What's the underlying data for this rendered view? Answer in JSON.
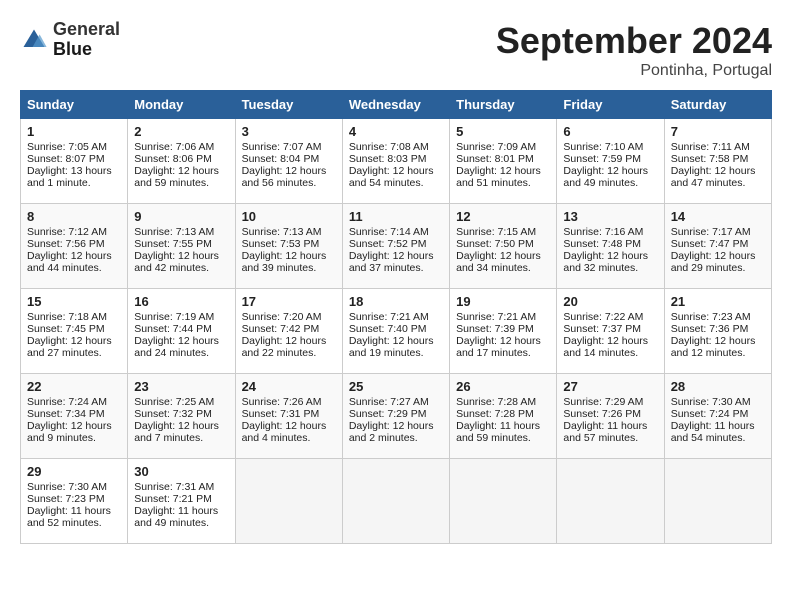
{
  "header": {
    "logo_line1": "General",
    "logo_line2": "Blue",
    "month_title": "September 2024",
    "location": "Pontinha, Portugal"
  },
  "days_of_week": [
    "Sunday",
    "Monday",
    "Tuesday",
    "Wednesday",
    "Thursday",
    "Friday",
    "Saturday"
  ],
  "weeks": [
    [
      {
        "day": "1",
        "lines": [
          "Sunrise: 7:05 AM",
          "Sunset: 8:07 PM",
          "Daylight: 13 hours",
          "and 1 minute."
        ]
      },
      {
        "day": "2",
        "lines": [
          "Sunrise: 7:06 AM",
          "Sunset: 8:06 PM",
          "Daylight: 12 hours",
          "and 59 minutes."
        ]
      },
      {
        "day": "3",
        "lines": [
          "Sunrise: 7:07 AM",
          "Sunset: 8:04 PM",
          "Daylight: 12 hours",
          "and 56 minutes."
        ]
      },
      {
        "day": "4",
        "lines": [
          "Sunrise: 7:08 AM",
          "Sunset: 8:03 PM",
          "Daylight: 12 hours",
          "and 54 minutes."
        ]
      },
      {
        "day": "5",
        "lines": [
          "Sunrise: 7:09 AM",
          "Sunset: 8:01 PM",
          "Daylight: 12 hours",
          "and 51 minutes."
        ]
      },
      {
        "day": "6",
        "lines": [
          "Sunrise: 7:10 AM",
          "Sunset: 7:59 PM",
          "Daylight: 12 hours",
          "and 49 minutes."
        ]
      },
      {
        "day": "7",
        "lines": [
          "Sunrise: 7:11 AM",
          "Sunset: 7:58 PM",
          "Daylight: 12 hours",
          "and 47 minutes."
        ]
      }
    ],
    [
      {
        "day": "8",
        "lines": [
          "Sunrise: 7:12 AM",
          "Sunset: 7:56 PM",
          "Daylight: 12 hours",
          "and 44 minutes."
        ]
      },
      {
        "day": "9",
        "lines": [
          "Sunrise: 7:13 AM",
          "Sunset: 7:55 PM",
          "Daylight: 12 hours",
          "and 42 minutes."
        ]
      },
      {
        "day": "10",
        "lines": [
          "Sunrise: 7:13 AM",
          "Sunset: 7:53 PM",
          "Daylight: 12 hours",
          "and 39 minutes."
        ]
      },
      {
        "day": "11",
        "lines": [
          "Sunrise: 7:14 AM",
          "Sunset: 7:52 PM",
          "Daylight: 12 hours",
          "and 37 minutes."
        ]
      },
      {
        "day": "12",
        "lines": [
          "Sunrise: 7:15 AM",
          "Sunset: 7:50 PM",
          "Daylight: 12 hours",
          "and 34 minutes."
        ]
      },
      {
        "day": "13",
        "lines": [
          "Sunrise: 7:16 AM",
          "Sunset: 7:48 PM",
          "Daylight: 12 hours",
          "and 32 minutes."
        ]
      },
      {
        "day": "14",
        "lines": [
          "Sunrise: 7:17 AM",
          "Sunset: 7:47 PM",
          "Daylight: 12 hours",
          "and 29 minutes."
        ]
      }
    ],
    [
      {
        "day": "15",
        "lines": [
          "Sunrise: 7:18 AM",
          "Sunset: 7:45 PM",
          "Daylight: 12 hours",
          "and 27 minutes."
        ]
      },
      {
        "day": "16",
        "lines": [
          "Sunrise: 7:19 AM",
          "Sunset: 7:44 PM",
          "Daylight: 12 hours",
          "and 24 minutes."
        ]
      },
      {
        "day": "17",
        "lines": [
          "Sunrise: 7:20 AM",
          "Sunset: 7:42 PM",
          "Daylight: 12 hours",
          "and 22 minutes."
        ]
      },
      {
        "day": "18",
        "lines": [
          "Sunrise: 7:21 AM",
          "Sunset: 7:40 PM",
          "Daylight: 12 hours",
          "and 19 minutes."
        ]
      },
      {
        "day": "19",
        "lines": [
          "Sunrise: 7:21 AM",
          "Sunset: 7:39 PM",
          "Daylight: 12 hours",
          "and 17 minutes."
        ]
      },
      {
        "day": "20",
        "lines": [
          "Sunrise: 7:22 AM",
          "Sunset: 7:37 PM",
          "Daylight: 12 hours",
          "and 14 minutes."
        ]
      },
      {
        "day": "21",
        "lines": [
          "Sunrise: 7:23 AM",
          "Sunset: 7:36 PM",
          "Daylight: 12 hours",
          "and 12 minutes."
        ]
      }
    ],
    [
      {
        "day": "22",
        "lines": [
          "Sunrise: 7:24 AM",
          "Sunset: 7:34 PM",
          "Daylight: 12 hours",
          "and 9 minutes."
        ]
      },
      {
        "day": "23",
        "lines": [
          "Sunrise: 7:25 AM",
          "Sunset: 7:32 PM",
          "Daylight: 12 hours",
          "and 7 minutes."
        ]
      },
      {
        "day": "24",
        "lines": [
          "Sunrise: 7:26 AM",
          "Sunset: 7:31 PM",
          "Daylight: 12 hours",
          "and 4 minutes."
        ]
      },
      {
        "day": "25",
        "lines": [
          "Sunrise: 7:27 AM",
          "Sunset: 7:29 PM",
          "Daylight: 12 hours",
          "and 2 minutes."
        ]
      },
      {
        "day": "26",
        "lines": [
          "Sunrise: 7:28 AM",
          "Sunset: 7:28 PM",
          "Daylight: 11 hours",
          "and 59 minutes."
        ]
      },
      {
        "day": "27",
        "lines": [
          "Sunrise: 7:29 AM",
          "Sunset: 7:26 PM",
          "Daylight: 11 hours",
          "and 57 minutes."
        ]
      },
      {
        "day": "28",
        "lines": [
          "Sunrise: 7:30 AM",
          "Sunset: 7:24 PM",
          "Daylight: 11 hours",
          "and 54 minutes."
        ]
      }
    ],
    [
      {
        "day": "29",
        "lines": [
          "Sunrise: 7:30 AM",
          "Sunset: 7:23 PM",
          "Daylight: 11 hours",
          "and 52 minutes."
        ]
      },
      {
        "day": "30",
        "lines": [
          "Sunrise: 7:31 AM",
          "Sunset: 7:21 PM",
          "Daylight: 11 hours",
          "and 49 minutes."
        ]
      },
      {
        "day": "",
        "lines": []
      },
      {
        "day": "",
        "lines": []
      },
      {
        "day": "",
        "lines": []
      },
      {
        "day": "",
        "lines": []
      },
      {
        "day": "",
        "lines": []
      }
    ]
  ]
}
